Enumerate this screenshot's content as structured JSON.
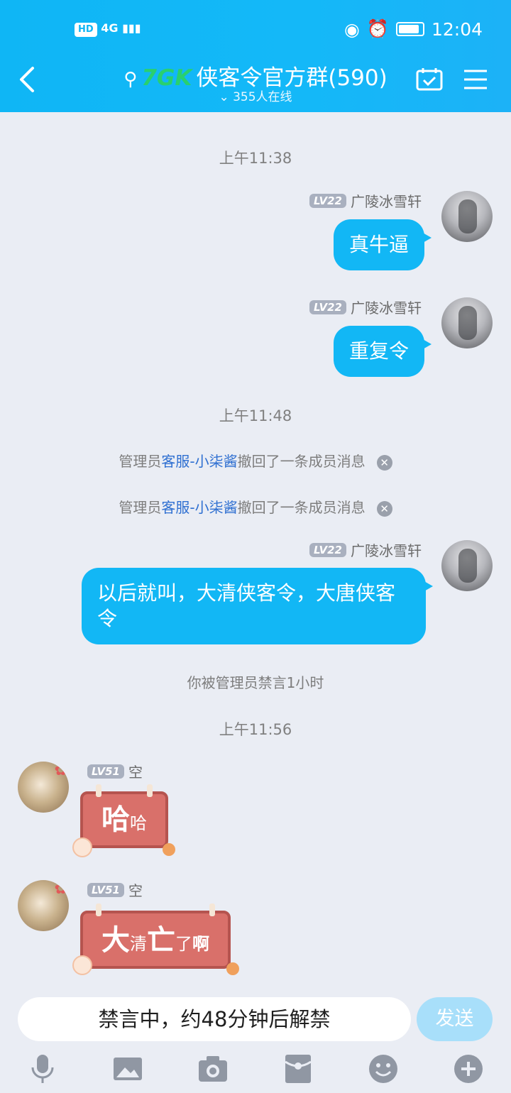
{
  "status_bar": {
    "left_badge": "HD",
    "signal": "4G",
    "time": "12:04"
  },
  "header": {
    "title": "侠客令官方群(590)",
    "logo_text": "7GK",
    "online": "355人在线"
  },
  "messages": {
    "time1": "上午11:38",
    "m1": {
      "level": "LV22",
      "sender": "广陵冰雪轩",
      "text": "真牛逼"
    },
    "m2": {
      "level": "LV22",
      "sender": "广陵冰雪轩",
      "text": "重复令"
    },
    "time2": "上午11:48",
    "sys1": {
      "prefix": "管理员",
      "link": "客服-小柒酱",
      "suffix": "撤回了一条成员消息"
    },
    "sys2": {
      "prefix": "管理员",
      "link": "客服-小柒酱",
      "suffix": "撤回了一条成员消息"
    },
    "m3": {
      "level": "LV22",
      "sender": "广陵冰雪轩",
      "text": "以后就叫，大清侠客令，大唐侠客令"
    },
    "sys3": "你被管理员禁言1小时",
    "time3": "上午11:56",
    "m4": {
      "level": "LV51",
      "sender": "空",
      "sticker_big": "哈",
      "sticker_small": "哈"
    },
    "m5": {
      "level": "LV51",
      "sender": "空",
      "sticker_a": "大",
      "sticker_b": "清",
      "sticker_c": "亡",
      "sticker_d": "了",
      "sticker_e": "啊"
    }
  },
  "input": {
    "muted_text": "禁言中，约48分钟后解禁",
    "send_label": "发送"
  },
  "colors": {
    "header": "#12b7f5",
    "bubble": "#12b7f5",
    "link": "#2e6fd1"
  },
  "toolbar_icons": [
    "microphone-icon",
    "image-icon",
    "camera-icon",
    "red-packet-icon",
    "emoji-icon",
    "plus-icon"
  ]
}
